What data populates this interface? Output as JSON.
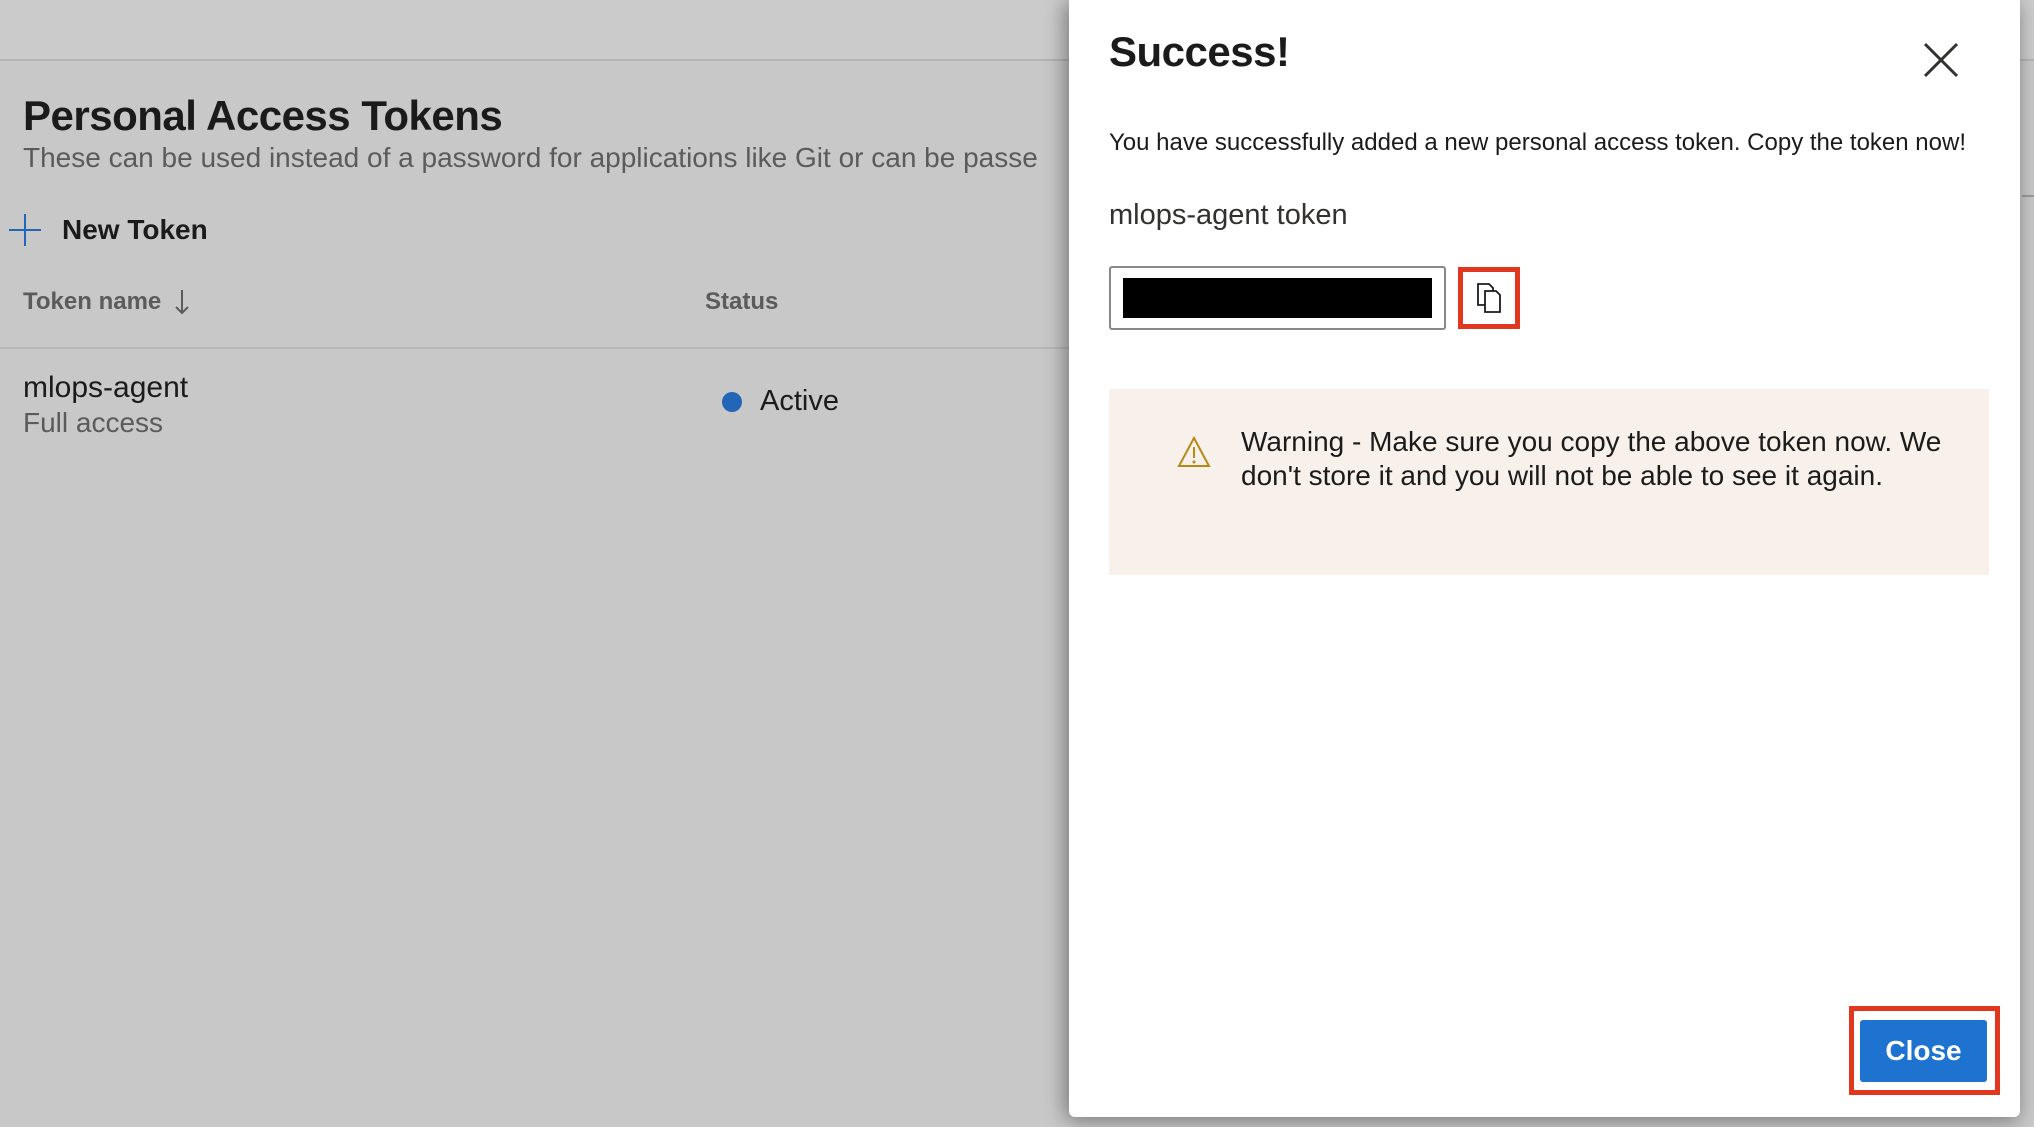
{
  "page": {
    "title": "Personal Access Tokens",
    "subtitle": "These can be used instead of a password for applications like Git or can be passe",
    "new_token_label": "New Token"
  },
  "table": {
    "columns": [
      "Token name",
      "Status"
    ],
    "rows": [
      {
        "name": "mlops-agent",
        "scope": "Full access",
        "status": "Active"
      }
    ]
  },
  "dialog": {
    "title": "Success!",
    "message": "You have successfully added a new personal access token. Copy the token now!",
    "token_label": "mlops-agent token",
    "warning": "Warning - Make sure you copy the above token now. We don't store it and you will not be able to see it again.",
    "close_label": "Close"
  },
  "icons": {
    "new_token": "plus-icon",
    "sort": "arrow-down-icon",
    "status": "status-dot-icon",
    "dismiss": "close-icon",
    "copy": "copy-icon",
    "warning": "warning-icon"
  },
  "colors": {
    "accent": "#1f73d0",
    "status_active": "#2266b5",
    "highlight": "#e2371f",
    "warning_bg": "#f7f0eb",
    "overlay": "#c8c8c8"
  }
}
